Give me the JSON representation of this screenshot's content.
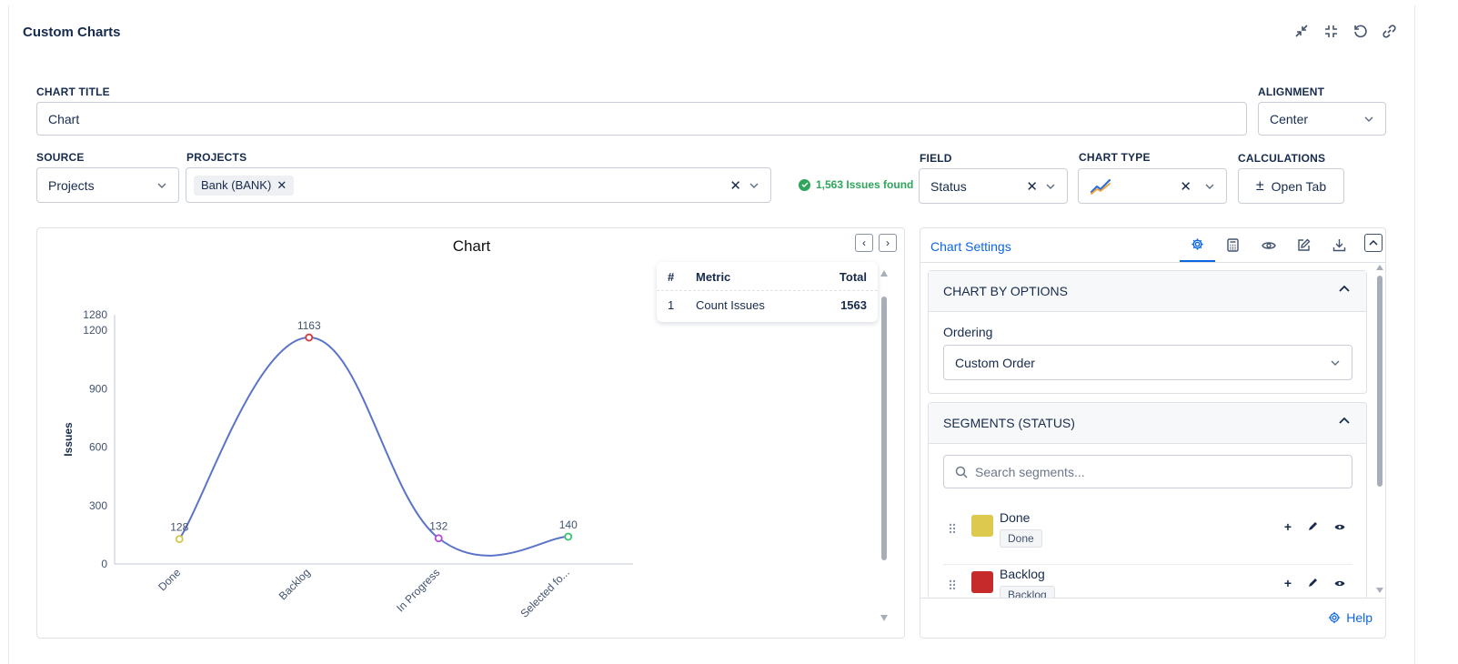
{
  "header": {
    "title": "Custom Charts",
    "icons": [
      "minimize-icon",
      "exit-fullscreen-icon",
      "reset-icon",
      "link-icon"
    ]
  },
  "form": {
    "chart_title_label": "CHART TITLE",
    "chart_title_value": "Chart",
    "alignment_label": "ALIGNMENT",
    "alignment_value": "Center",
    "source_label": "SOURCE",
    "source_value": "Projects",
    "projects_label": "PROJECTS",
    "project_tag": "Bank (BANK)",
    "issues_found": "1,563 Issues found",
    "field_label": "FIELD",
    "field_value": "Status",
    "chart_type_label": "CHART TYPE",
    "calculations_label": "CALCULATIONS",
    "open_tab": "Open Tab"
  },
  "metric_table": {
    "headers": [
      "#",
      "Metric",
      "Total"
    ],
    "rows": [
      {
        "num": "1",
        "metric": "Count Issues",
        "total": "1563"
      }
    ]
  },
  "chart_data": {
    "type": "line",
    "title": "Chart",
    "xlabel": "",
    "ylabel": "Issues",
    "categories": [
      "Done",
      "Backlog",
      "In Progress",
      "Selected fo..."
    ],
    "values": [
      128,
      1163,
      132,
      140
    ],
    "value_labels": [
      "128",
      "1163",
      "132",
      "140"
    ],
    "point_colors": [
      "#d4c64a",
      "#d33b3b",
      "#b54ad4",
      "#35c46b"
    ],
    "line_color": "#5b73c9",
    "yticks": [
      0,
      300,
      600,
      900,
      1200,
      1280
    ],
    "ylim": [
      0,
      1280
    ],
    "grid": false,
    "smooth": true
  },
  "settings": {
    "title": "Chart Settings",
    "tabs": [
      "gear-icon",
      "calculator-icon",
      "eye-icon",
      "edit-icon",
      "download-icon"
    ],
    "chart_by_options": "CHART BY OPTIONS",
    "ordering_label": "Ordering",
    "ordering_value": "Custom Order",
    "segments_title": "SEGMENTS (STATUS)",
    "search_placeholder": "Search segments...",
    "segments": [
      {
        "name": "Done",
        "tag": "Done",
        "color": "#ddc94e"
      },
      {
        "name": "Backlog",
        "tag": "Backlog",
        "color": "#c62a2a"
      }
    ],
    "help": "Help"
  }
}
